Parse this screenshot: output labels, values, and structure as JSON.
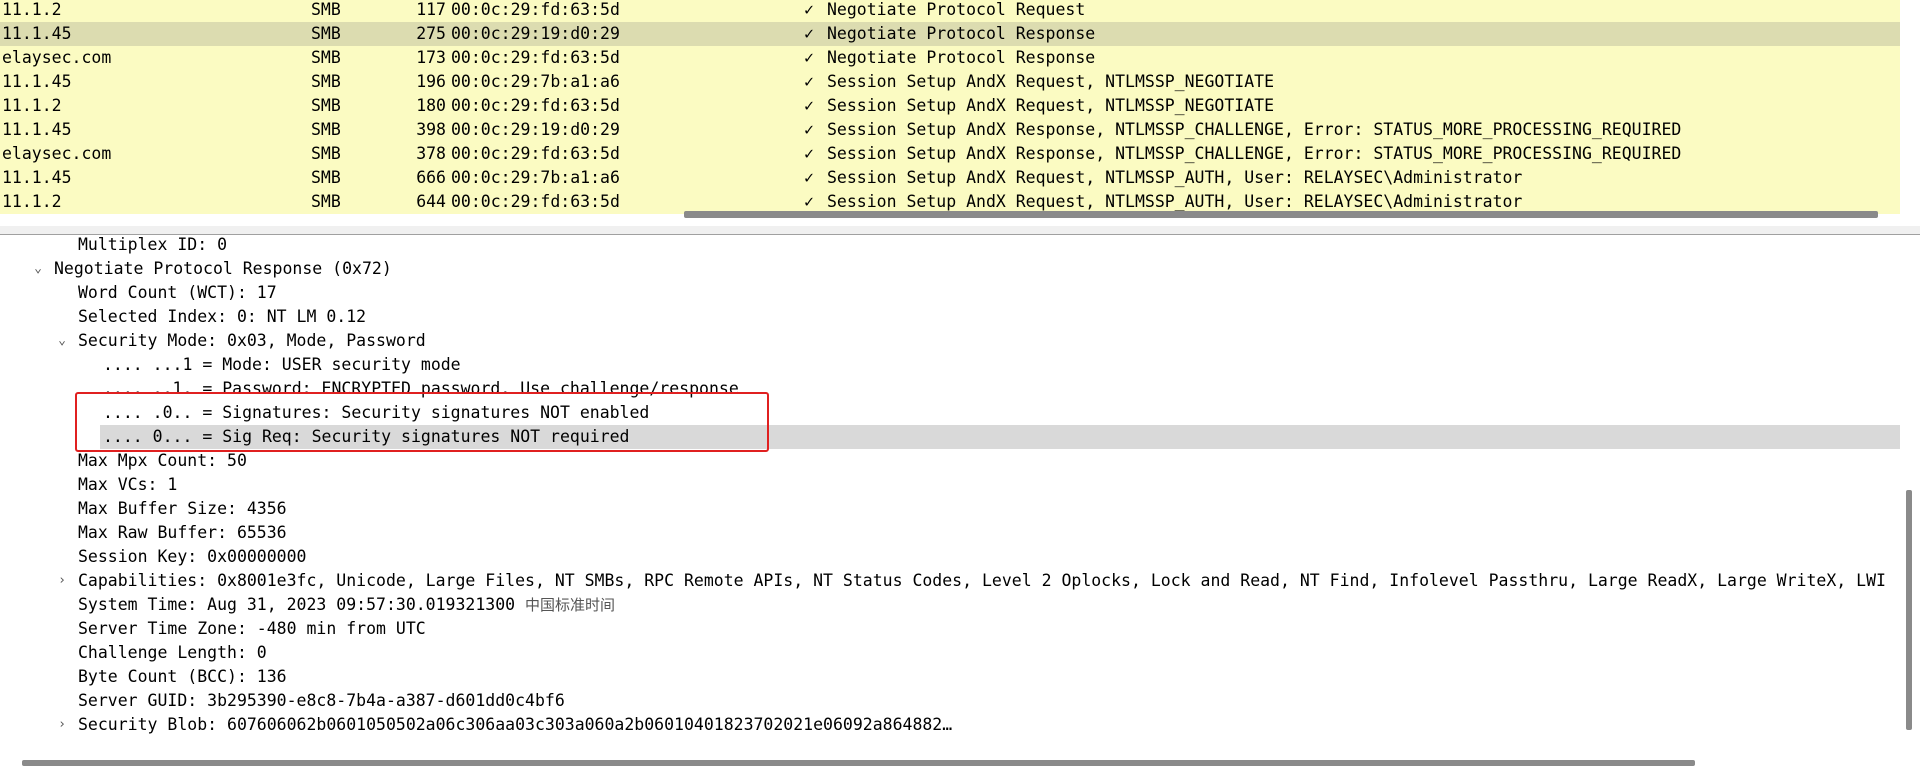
{
  "packet_list": {
    "rows": [
      {
        "addr": "11.1.2",
        "proto": "SMB",
        "len": "117",
        "mac": "00:0c:29:fd:63:5d",
        "check": "✓",
        "info": "Negotiate Protocol Request"
      },
      {
        "addr": "11.1.45",
        "proto": "SMB",
        "len": "275",
        "mac": "00:0c:29:19:d0:29",
        "check": "✓",
        "info": "Negotiate Protocol Response"
      },
      {
        "addr": "elaysec.com",
        "proto": "SMB",
        "len": "173",
        "mac": "00:0c:29:fd:63:5d",
        "check": "✓",
        "info": "Negotiate Protocol Response"
      },
      {
        "addr": "11.1.45",
        "proto": "SMB",
        "len": "196",
        "mac": "00:0c:29:7b:a1:a6",
        "check": "✓",
        "info": "Session Setup AndX Request, NTLMSSP_NEGOTIATE"
      },
      {
        "addr": "11.1.2",
        "proto": "SMB",
        "len": "180",
        "mac": "00:0c:29:fd:63:5d",
        "check": "✓",
        "info": "Session Setup AndX Request, NTLMSSP_NEGOTIATE"
      },
      {
        "addr": "11.1.45",
        "proto": "SMB",
        "len": "398",
        "mac": "00:0c:29:19:d0:29",
        "check": "✓",
        "info": "Session Setup AndX Response, NTLMSSP_CHALLENGE, Error: STATUS_MORE_PROCESSING_REQUIRED"
      },
      {
        "addr": "elaysec.com",
        "proto": "SMB",
        "len": "378",
        "mac": "00:0c:29:fd:63:5d",
        "check": "✓",
        "info": "Session Setup AndX Response, NTLMSSP_CHALLENGE, Error: STATUS_MORE_PROCESSING_REQUIRED"
      },
      {
        "addr": "11.1.45",
        "proto": "SMB",
        "len": "666",
        "mac": "00:0c:29:7b:a1:a6",
        "check": "✓",
        "info": "Session Setup AndX Request, NTLMSSP_AUTH, User: RELAYSEC\\Administrator"
      },
      {
        "addr": "11.1.2",
        "proto": "SMB",
        "len": "644",
        "mac": "00:0c:29:fd:63:5d",
        "check": "✓",
        "info": "Session Setup AndX Request, NTLMSSP_AUTH, User: RELAYSEC\\Administrator"
      }
    ]
  },
  "details": {
    "lines": [
      {
        "text": "Multiplex ID: 0",
        "arrow": ""
      },
      {
        "text": "Negotiate Protocol Response (0x72)",
        "arrow": "expanded"
      },
      {
        "text": "Word Count (WCT): 17",
        "arrow": ""
      },
      {
        "text": "Selected Index: 0: NT LM 0.12",
        "arrow": ""
      },
      {
        "text": "Security Mode: 0x03, Mode, Password",
        "arrow": "expanded"
      },
      {
        "text": ".... ...1 = Mode: USER security mode",
        "arrow": ""
      },
      {
        "text": ".... ..1. = Password: ENCRYPTED password. Use challenge/response",
        "arrow": ""
      },
      {
        "text": ".... .0.. = Signatures: Security signatures NOT enabled",
        "arrow": ""
      },
      {
        "text": ".... 0... = Sig Req: Security signatures NOT required",
        "arrow": ""
      },
      {
        "text": "Max Mpx Count: 50",
        "arrow": ""
      },
      {
        "text": "Max VCs: 1",
        "arrow": ""
      },
      {
        "text": "Max Buffer Size: 4356",
        "arrow": ""
      },
      {
        "text": "Max Raw Buffer: 65536",
        "arrow": ""
      },
      {
        "text": "Session Key: 0x00000000",
        "arrow": ""
      },
      {
        "text": "Capabilities: 0x8001e3fc, Unicode, Large Files, NT SMBs, RPC Remote APIs, NT Status Codes, Level 2 Oplocks, Lock and Read, NT Find, Infolevel Passthru, Large ReadX, Large WriteX, LWI",
        "arrow": "collapsed"
      },
      {
        "text": "System Time: Aug 31, 2023 09:57:30.019321300 ",
        "suffix": "中国标准时间",
        "arrow": ""
      },
      {
        "text": "Server Time Zone: -480 min from UTC",
        "arrow": ""
      },
      {
        "text": "Challenge Length: 0",
        "arrow": ""
      },
      {
        "text": "Byte Count (BCC): 136",
        "arrow": ""
      },
      {
        "text": "Server GUID: 3b295390-e8c8-7b4a-a387-d601dd0c4bf6",
        "arrow": ""
      },
      {
        "text": "Security Blob: 607606062b0601050502a06c306aa03c303a060a2b06010401823702021e06092a864882…",
        "arrow": "collapsed"
      }
    ],
    "expanded_glyph": "⌄",
    "collapsed_glyph": "›"
  }
}
